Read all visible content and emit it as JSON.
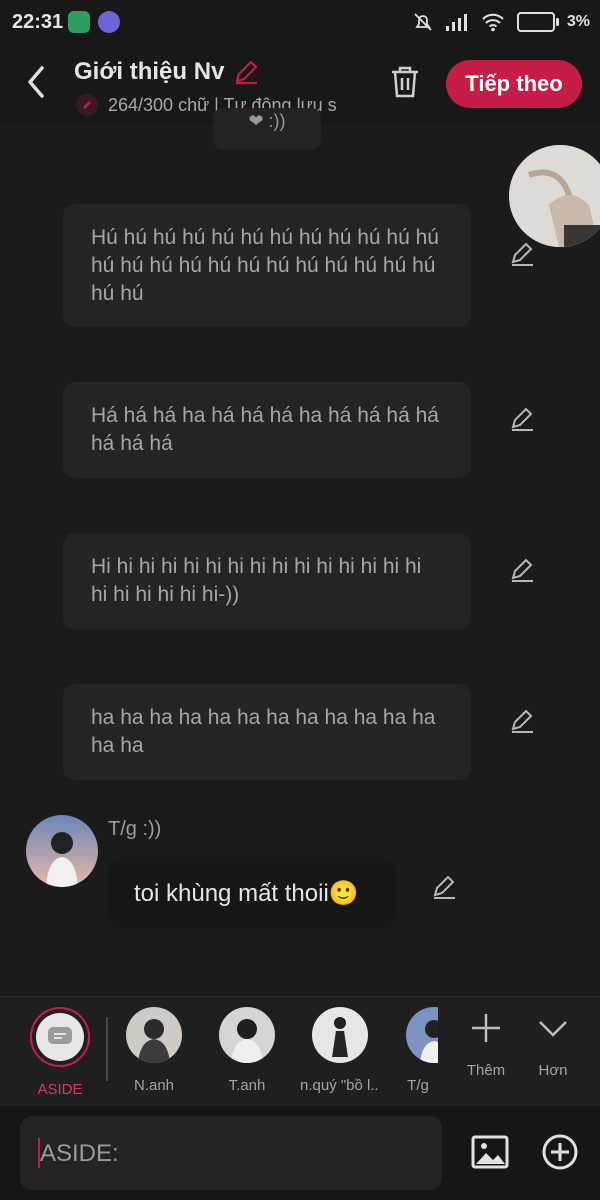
{
  "status_bar": {
    "time": "22:31",
    "battery": "3%"
  },
  "header": {
    "title": "Giới thiệu Nv",
    "subtitle": "264/300 chữ | Tự động lưu s",
    "next_label": "Tiếp theo"
  },
  "top_card_text": "❤ :))",
  "messages": [
    {
      "text": "Hú hú hú hú hú hú hú hú hú hú hú hú hú hú hú hú hú hú hú hú hú hú hú hú hú hú"
    },
    {
      "text": "Há há há ha há há há ha há há há há há há há"
    },
    {
      "text": "Hi hi hi hi hi hi hi hi hi hi hi hi hi hi hi hi hi hi hi hi hi-))"
    },
    {
      "text": "ha ha ha ha ha ha ha ha ha ha ha ha ha ha"
    }
  ],
  "dialogue": {
    "speaker": "T/g :))",
    "text": "toi khùng mất thoii🙂"
  },
  "characters": [
    {
      "name": "ASIDE"
    },
    {
      "name": "N.anh"
    },
    {
      "name": "T.anh"
    },
    {
      "name": "n.quý \"bồ l..."
    },
    {
      "name": "T/g"
    }
  ],
  "tools": {
    "add_label": "Thêm",
    "more_label": "Hơn"
  },
  "input": {
    "value": "ASIDE:"
  },
  "colors": {
    "accent": "#c51d48",
    "background": "#1b1b1b"
  }
}
